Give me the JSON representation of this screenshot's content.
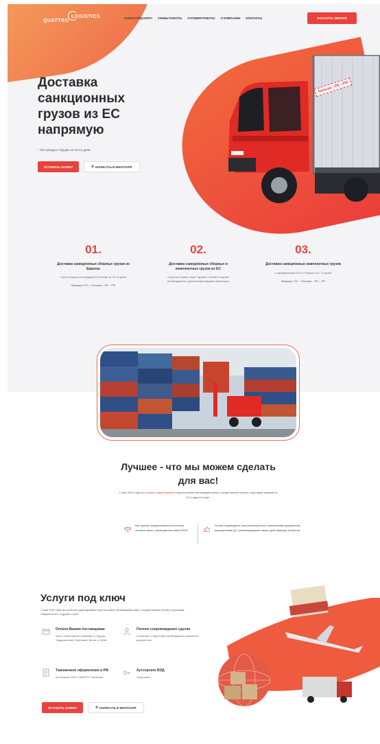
{
  "header": {
    "logo_top": "LOGISTICS",
    "logo_bottom": "QUATTRO",
    "nav": [
      "УСЛУГИ ПОД КЛЮЧ",
      "СХЕМЫ РАБОТЫ",
      "УСЛОВИЯ РАБОТЫ",
      "О КОМПАНИИ",
      "КОНТАКТЫ"
    ],
    "cta": "ЗАКАЗАТЬ ЗВОНОК"
  },
  "hero": {
    "title": "Доставка санкционных грузов из ЕС напрямую",
    "subtitle": "– без заезда в Турцию за 10-14 дней",
    "btn_primary": "ОСТАВИТЬ ЗАЯВКУ",
    "btn_secondary": "НАПИСАТЬ В WHATSAPP",
    "truck_tag": "Польша – РБ – РФ"
  },
  "steps": [
    {
      "num": "01.",
      "title": "Доставка санкционных сборных грузов из Европы",
      "desc": "через склад консолидации в Польше за 10-14 дней",
      "route": "Маршрут: ЕС – Польша – РБ – РФ"
    },
    {
      "num": "02.",
      "title": "Доставка санкционных сборных и комплектных грузов из ЕС",
      "desc": "в третьи страны через Турцию и Китай в случае необходимости различными видами транспорта",
      "route": ""
    },
    {
      "num": "03.",
      "title": "Доставка санкционных комплектных грузов",
      "desc": "с оформлением EX1 в Польше за 7-10 дней",
      "route": "Маршрут: ЕС – Польша – РБ – РФ"
    }
  ],
  "best": {
    "title": "Лучшее - что мы можем сделать для вас!",
    "sub_before": "С мая 2022 года ",
    "sub_highlight": "мы успешно адаптируемся",
    "sub_after": " под постоянно меняющийся мир и осуществляем оплату и доставку товаров из ЕС и других стран.",
    "feature1": "Все сделки осуществляются в полном соответствии с законодательством ЕАЭС",
    "feature2": "Готовы подтвердить наш успешный опыт комплектами документов, выпущенными ДТ, рекомендациями наших действующих Клиентов"
  },
  "services": {
    "title": "Услуги под ключ",
    "subtitle": "С мая 2022 года мы успешно адаптируемся под постоянно меняющийся мир и осуществляем оплату и доставку товаров из ЕС и других стран.",
    "items": [
      {
        "title": "Оплата Вашим поставщикам",
        "desc": "через селективные компании в Турции, Таджикистане, Монголии, Китае и Литве"
      },
      {
        "title": "Полное сопровождение сделки",
        "desc": "и помощь в подготовке необходимого комплекта документов"
      },
      {
        "title": "Таможенное оформление в РФ",
        "desc": "на печатью ООО «КВАТРО Логистик»"
      },
      {
        "title": "Аутсорсинг ВЭД",
        "desc": "«под ключ»"
      }
    ],
    "btn_primary": "ОСТАВИТЬ ЗАЯВКУ",
    "btn_secondary": "НАПИСАТЬ В WHATSAPP"
  },
  "colors": {
    "accent": "#e9423c",
    "orange": "#f4a05b",
    "bg": "#f4f4f6"
  }
}
